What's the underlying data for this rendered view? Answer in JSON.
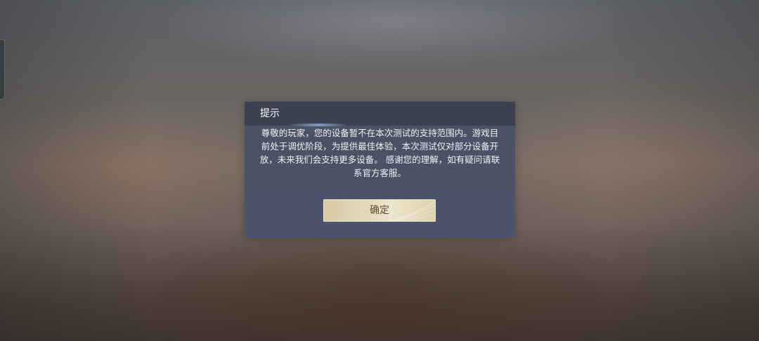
{
  "dialog": {
    "title": "提示",
    "message": "尊敬的玩家，您的设备暂不在本次测试的支持范围内。游戏目\n前处于调优阶段，为提供最佳体验，本次测试仅对部分设备开\n放，未来我们会支持更多设备。 感谢您的理解，如有疑问请联\n系官方客服。",
    "confirm_label": "确定"
  },
  "colors": {
    "dialog_background": "#4a5266",
    "header_background": "#3c4151",
    "button_gold": "#e5dbc0",
    "button_text": "#5a4b33"
  }
}
